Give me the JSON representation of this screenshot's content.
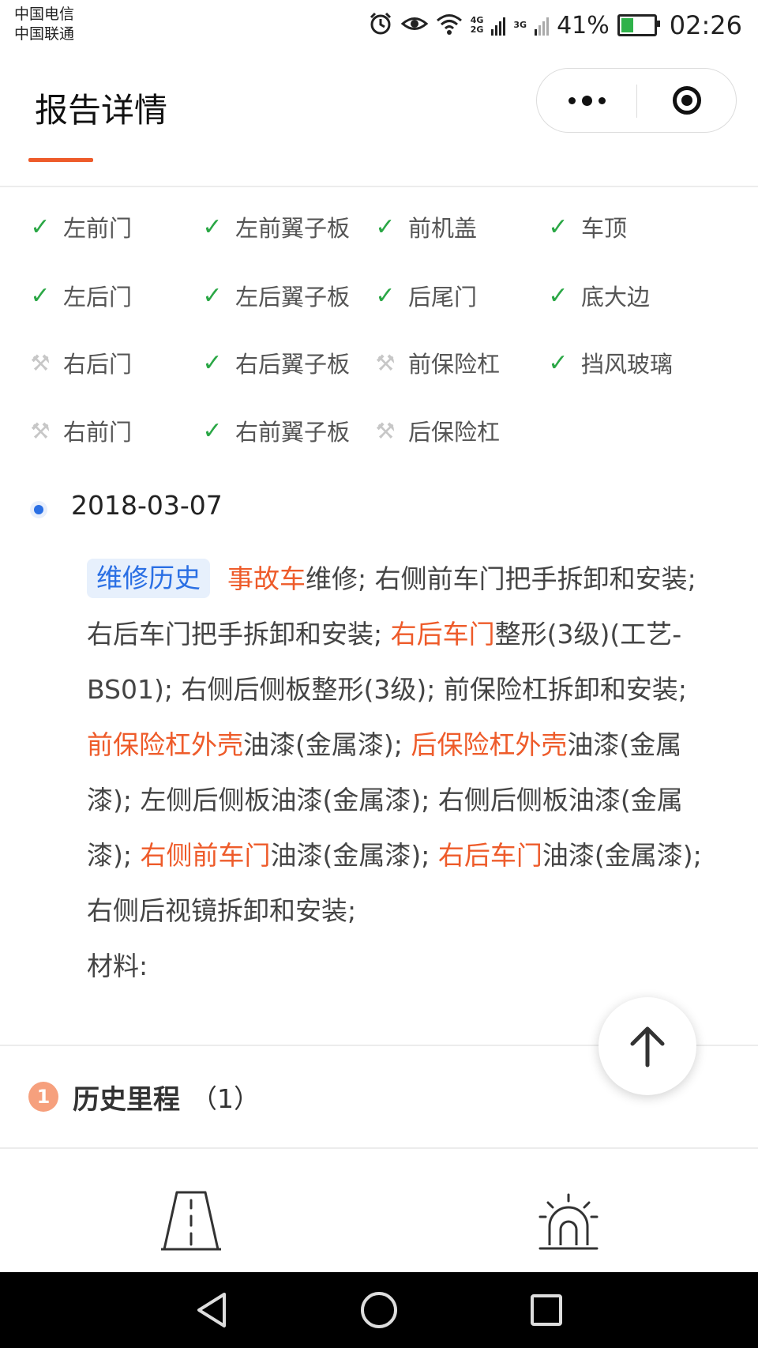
{
  "status_bar": {
    "carrier1": "中国电信",
    "carrier2": "中国联通",
    "net1_top": "4G",
    "net1_bottom": "2G",
    "net2": "3G",
    "battery": "41%",
    "battery_level": 0.41,
    "time": "02:26"
  },
  "nav": {
    "title": "报告详情",
    "more_icon": "more-dots-icon",
    "close_icon": "record-target-icon"
  },
  "parts": [
    {
      "label": "左前门",
      "status": "ok"
    },
    {
      "label": "左前翼子板",
      "status": "ok"
    },
    {
      "label": "前机盖",
      "status": "ok"
    },
    {
      "label": "车顶",
      "status": "ok"
    },
    {
      "label": "左后门",
      "status": "ok"
    },
    {
      "label": "左后翼子板",
      "status": "ok"
    },
    {
      "label": "后尾门",
      "status": "ok"
    },
    {
      "label": "底大边",
      "status": "ok"
    },
    {
      "label": "右后门",
      "status": "repaired"
    },
    {
      "label": "右后翼子板",
      "status": "ok"
    },
    {
      "label": "前保险杠",
      "status": "repaired"
    },
    {
      "label": "挡风玻璃",
      "status": "ok"
    },
    {
      "label": "右前门",
      "status": "repaired"
    },
    {
      "label": "右前翼子板",
      "status": "ok"
    },
    {
      "label": "后保险杠",
      "status": "repaired"
    }
  ],
  "record": {
    "date": "2018-03-07",
    "badge": "维修历史",
    "segments": [
      {
        "t": "事故车",
        "hl": true
      },
      {
        "t": "维修; 右侧前车门把手拆卸和安装; 右后车门把手拆卸和安装; ",
        "hl": false
      },
      {
        "t": "右后车门",
        "hl": true
      },
      {
        "t": "整形(3级)(工艺-BS01); 右侧后侧板整形(3级); 前保险杠拆卸和安装; ",
        "hl": false
      },
      {
        "t": "前保险杠外壳",
        "hl": true
      },
      {
        "t": "油漆(金属漆); ",
        "hl": false
      },
      {
        "t": "后保险杠外壳",
        "hl": true
      },
      {
        "t": "油漆(金属漆); 左侧后侧板油漆(金属漆); 右侧后侧板油漆(金属漆); ",
        "hl": false
      },
      {
        "t": "右侧前车门",
        "hl": true
      },
      {
        "t": "油漆(金属漆); ",
        "hl": false
      },
      {
        "t": "右后车门",
        "hl": true
      },
      {
        "t": "油漆(金属漆); 右侧后视镜拆卸和安装;",
        "hl": false
      }
    ],
    "material": "材料:"
  },
  "history": {
    "index": "1",
    "title": "历史里程",
    "count": "（1）"
  },
  "colors": {
    "accent": "#ee5b2a",
    "ok": "#2aa745",
    "blue": "#2a6fe4"
  },
  "icons": {
    "fab": "arrow-up-icon",
    "bottom_left": "road-icon",
    "bottom_right": "alarm-light-icon"
  }
}
